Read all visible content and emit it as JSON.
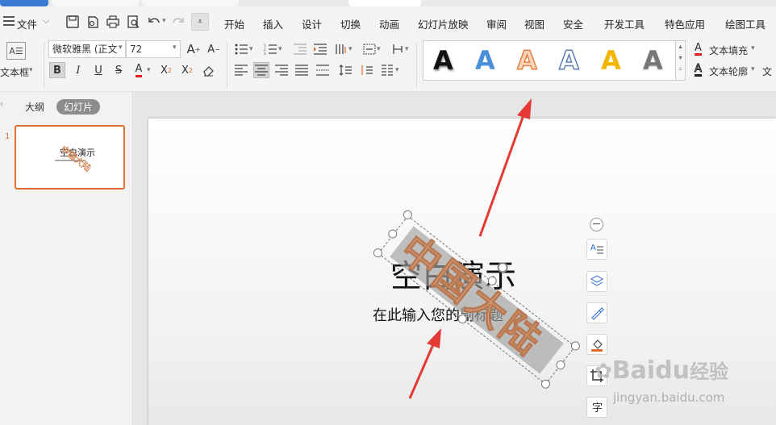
{
  "menu": {
    "file_label": "文件",
    "tabs": [
      "开始",
      "插入",
      "设计",
      "切换",
      "动画",
      "幻灯片放映",
      "审阅",
      "视图",
      "安全",
      "开发工具",
      "特色应用",
      "绘图工具"
    ]
  },
  "ribbon": {
    "textbox_label": "文本框",
    "font_name": "微软雅黑 (正文",
    "font_size": "72",
    "text_fill_label": "文本填充",
    "text_outline_label": "文本轮廓",
    "text_effect_label": "文",
    "style_glyph": "A"
  },
  "left_panel": {
    "tab_outline": "大纲",
    "tab_slides": "幻灯片",
    "slide_number": "1"
  },
  "slide": {
    "title_text": "空白演示",
    "subtitle_text": "在此输入您的副标题",
    "wordart_text": "中国大陆"
  },
  "watermark": {
    "brand": "Baidu",
    "brand_cn": "经验",
    "url": "jingyan.baidu.com"
  },
  "colors": {
    "accent": "#e06e2e",
    "wordart_fill": "#d9a385",
    "arrow": "#e53935"
  }
}
